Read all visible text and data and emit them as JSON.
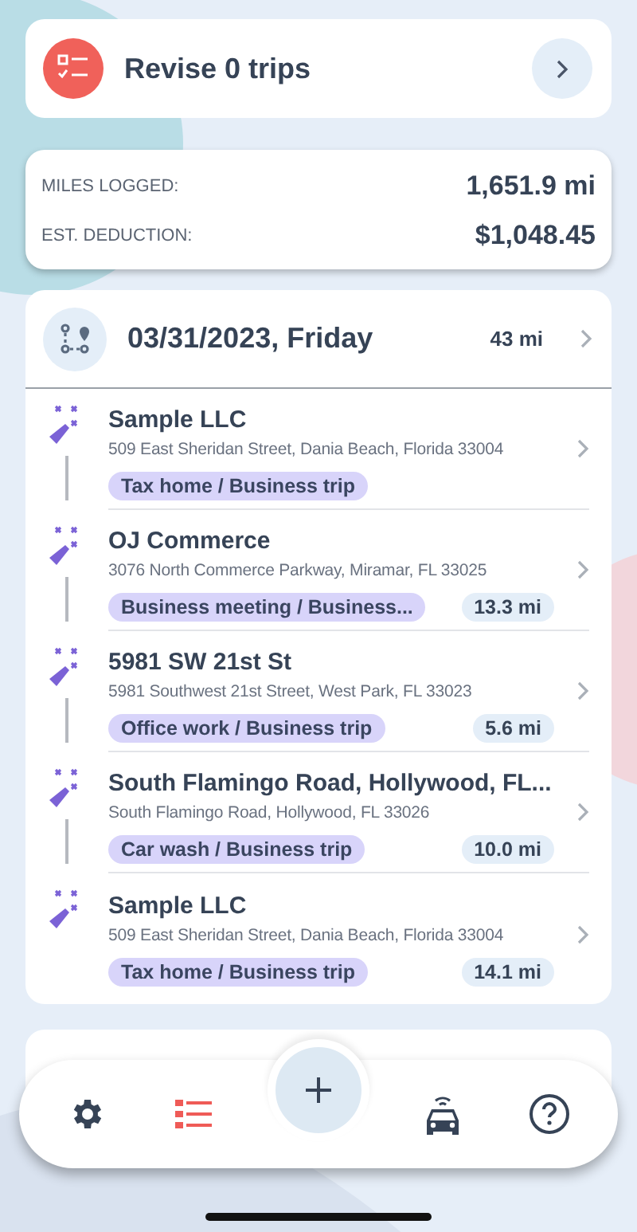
{
  "revise": {
    "label": "Revise 0 trips"
  },
  "stats": [
    {
      "label": "MILES LOGGED:",
      "value": "1,651.9 mi"
    },
    {
      "label": "EST. DEDUCTION:",
      "value": "$1,048.45"
    }
  ],
  "day": {
    "date": "03/31/2023, Friday",
    "distance": "43 mi",
    "trips": [
      {
        "name": "Sample LLC",
        "address": "509 East Sheridan Street, Dania Beach, Florida 33004",
        "tag": "Tax home / Business trip"
      },
      {
        "name": "OJ Commerce",
        "address": "3076 North Commerce Parkway, Miramar, FL 33025",
        "tag": "Business meeting / Business...",
        "distance": "13.3 mi"
      },
      {
        "name": "5981 SW 21st St",
        "address": "5981 Southwest 21st Street, West Park, FL 33023",
        "tag": "Office work / Business trip",
        "distance": "5.6 mi"
      },
      {
        "name": "South Flamingo Road, Hollywood, FL...",
        "address": "South Flamingo Road, Hollywood, FL 33026",
        "tag": "Car wash / Business trip",
        "distance": "10.0 mi"
      },
      {
        "name": "Sample LLC",
        "address": "509 East Sheridan Street, Dania Beach, Florida 33004",
        "tag": "Tax home / Business trip",
        "distance": "14.1 mi"
      }
    ]
  },
  "nav": [
    {
      "kind": "settings",
      "selected": false
    },
    {
      "kind": "list",
      "selected": true
    },
    {
      "kind": "add",
      "selected": false
    },
    {
      "kind": "car",
      "selected": false
    },
    {
      "kind": "help",
      "selected": false
    }
  ]
}
